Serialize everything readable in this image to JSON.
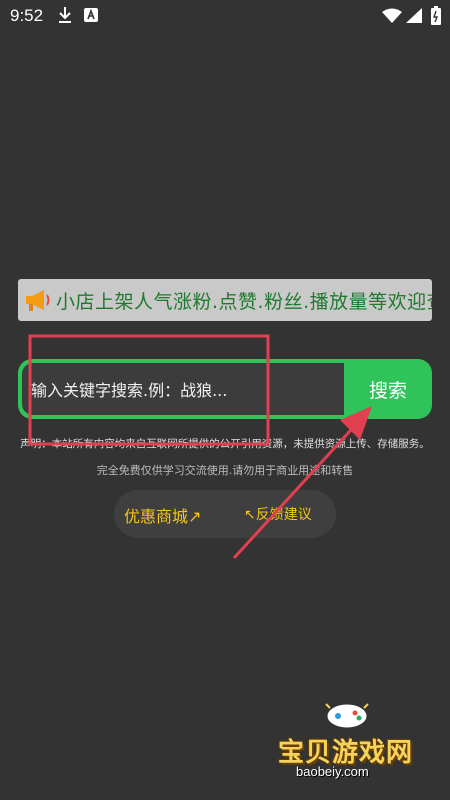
{
  "status_bar": {
    "time": "9:52",
    "icons": [
      "download-icon",
      "a-badge-icon",
      "wifi-icon",
      "signal-icon",
      "battery-icon"
    ]
  },
  "marquee": {
    "icon": "megaphone-icon",
    "text": "小店上架人气涨粉.点赞.粉丝.播放量等欢迎查看"
  },
  "search": {
    "placeholder": "输入关键字搜索.例：战狼...",
    "button_label": "搜索"
  },
  "disclaimer": {
    "line1": "声明：本站所有内容均来自互联网所提供的公开引用资源，未提供资源上传、存储服务。",
    "line2": "完全免费仅供学习交流使用.请勿用于商业用途和转售"
  },
  "links": {
    "shop": "优惠商城↗",
    "feedback": "↖反馈建议"
  },
  "watermark": {
    "text": "宝贝游戏网",
    "url": "baobeiy.com"
  },
  "colors": {
    "background": "#333333",
    "accent_green": "#2fc35a",
    "link_yellow": "#f5c518",
    "annotation_red": "#e04050"
  }
}
